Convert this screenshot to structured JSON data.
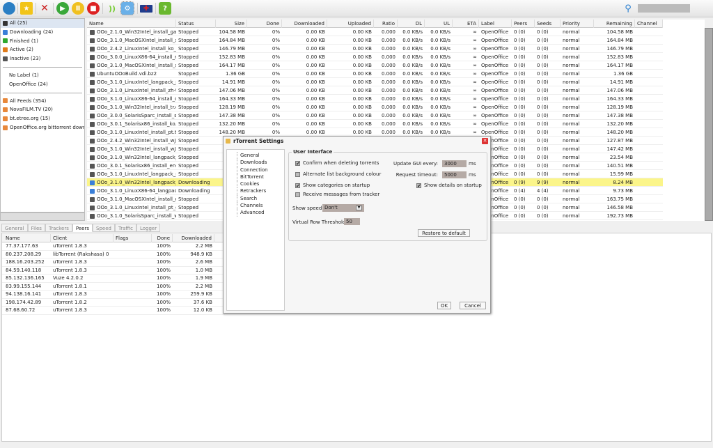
{
  "toolbar": {
    "icons": [
      "globe-icon",
      "star-icon",
      "delete-icon",
      "start-icon",
      "pause-icon",
      "stop-icon",
      "rss-icon",
      "settings-icon",
      "language-flag-icon",
      "help-icon"
    ],
    "search_value": ""
  },
  "sidebar": {
    "status": [
      {
        "label": "All (25)",
        "color": "#333"
      },
      {
        "label": "Downloading (24)",
        "color": "#3a7fd8"
      },
      {
        "label": "Finished (1)",
        "color": "#2ea82e"
      },
      {
        "label": "Active (2)",
        "color": "#e07b1a"
      },
      {
        "label": "Inactive (23)",
        "color": "#555"
      }
    ],
    "labels": [
      "No Label (1)",
      "OpenOffice (24)"
    ],
    "feeds": [
      "All Feeds (354)",
      "NovaFILM.TV (20)",
      "bt.etree.org (15)",
      "OpenOffice.org bittorrent downloa"
    ]
  },
  "table": {
    "columns": [
      "Name",
      "Status",
      "Size",
      "Done",
      "Downloaded",
      "Uploaded",
      "Ratio",
      "DL",
      "UL",
      "ETA",
      "Label",
      "Peers",
      "Seeds",
      "Priority",
      "Remaining",
      "Channel"
    ],
    "rows": [
      [
        "OOo_2.1.0_Win32Intel_install_ga.",
        "Stopped",
        "104.58 MB",
        "0%",
        "0.00 KB",
        "0.00 KB",
        "0.000",
        "0.0 KB/s",
        "0.0 KB/s",
        "∞",
        "OpenOffice",
        "0 (0)",
        "0 (0)",
        "normal",
        "104.58 MB",
        ""
      ],
      [
        "OOo_3.1.0_MacOSXIntel_install_sv",
        "Stopped",
        "164.84 MB",
        "0%",
        "0.00 KB",
        "0.00 KB",
        "0.000",
        "0.0 KB/s",
        "0.0 KB/s",
        "∞",
        "OpenOffice",
        "0 (0)",
        "0 (0)",
        "normal",
        "164.84 MB",
        ""
      ],
      [
        "OOo_2.4.2_LinuxIntel_install_ko_d",
        "Stopped",
        "146.79 MB",
        "0%",
        "0.00 KB",
        "0.00 KB",
        "0.000",
        "0.0 KB/s",
        "0.0 KB/s",
        "∞",
        "OpenOffice",
        "0 (0)",
        "0 (0)",
        "normal",
        "146.79 MB",
        ""
      ],
      [
        "OOo_3.0.0_LinuxX86-64_install_ru",
        "Stopped",
        "152.83 MB",
        "0%",
        "0.00 KB",
        "0.00 KB",
        "0.000",
        "0.0 KB/s",
        "0.0 KB/s",
        "∞",
        "OpenOffice",
        "0 (0)",
        "0 (0)",
        "normal",
        "152.83 MB",
        ""
      ],
      [
        "OOo_3.1.0_MacOSXIntel_install_sr",
        "Stopped",
        "164.17 MB",
        "0%",
        "0.00 KB",
        "0.00 KB",
        "0.000",
        "0.0 KB/s",
        "0.0 KB/s",
        "∞",
        "OpenOffice",
        "0 (0)",
        "0 (0)",
        "normal",
        "164.17 MB",
        ""
      ],
      [
        "UbuntuOOoBuild.vdi.bz2",
        "Stopped",
        "1.36 GB",
        "0%",
        "0.00 KB",
        "0.00 KB",
        "0.000",
        "0.0 KB/s",
        "0.0 KB/s",
        "∞",
        "OpenOffice",
        "0 (0)",
        "0 (0)",
        "normal",
        "1.36 GB",
        ""
      ],
      [
        "OOo_3.1.0_LinuxIntel_langpack_pl",
        "Stopped",
        "14.91 MB",
        "0%",
        "0.00 KB",
        "0.00 KB",
        "0.000",
        "0.0 KB/s",
        "0.0 KB/s",
        "∞",
        "OpenOffice",
        "0 (0)",
        "0 (0)",
        "normal",
        "14.91 MB",
        ""
      ],
      [
        "OOo_3.1.0_LinuxIntel_install_zh-tw",
        "Stopped",
        "147.06 MB",
        "0%",
        "0.00 KB",
        "0.00 KB",
        "0.000",
        "0.0 KB/s",
        "0.0 KB/s",
        "∞",
        "OpenOffice",
        "0 (0)",
        "0 (0)",
        "normal",
        "147.06 MB",
        ""
      ],
      [
        "OOo_3.1.0_LinuxX86-64_install_de",
        "Stopped",
        "164.33 MB",
        "0%",
        "0.00 KB",
        "0.00 KB",
        "0.000",
        "0.0 KB/s",
        "0.0 KB/s",
        "∞",
        "OpenOffice",
        "0 (0)",
        "0 (0)",
        "normal",
        "164.33 MB",
        ""
      ],
      [
        "OOo_3.1.0_Win32Intel_install_tr.e",
        "Stopped",
        "128.19 MB",
        "0%",
        "0.00 KB",
        "0.00 KB",
        "0.000",
        "0.0 KB/s",
        "0.0 KB/s",
        "∞",
        "OpenOffice",
        "0 (0)",
        "0 (0)",
        "normal",
        "128.19 MB",
        ""
      ],
      [
        "OOo_3.0.0_SolarisSparc_install_sv",
        "Stopped",
        "147.38 MB",
        "0%",
        "0.00 KB",
        "0.00 KB",
        "0.000",
        "0.0 KB/s",
        "0.0 KB/s",
        "∞",
        "OpenOffice",
        "0 (0)",
        "0 (0)",
        "normal",
        "147.38 MB",
        ""
      ],
      [
        "OOo_3.0.1_Solarisx86_install_ko.t",
        "Stopped",
        "132.20 MB",
        "0%",
        "0.00 KB",
        "0.00 KB",
        "0.000",
        "0.0 KB/s",
        "0.0 KB/s",
        "∞",
        "OpenOffice",
        "0 (0)",
        "0 (0)",
        "normal",
        "132.20 MB",
        ""
      ],
      [
        "OOo_3.1.0_LinuxIntel_install_pt.ta",
        "Stopped",
        "148.20 MB",
        "0%",
        "0.00 KB",
        "0.00 KB",
        "0.000",
        "0.0 KB/s",
        "0.0 KB/s",
        "∞",
        "OpenOffice",
        "0 (0)",
        "0 (0)",
        "normal",
        "148.20 MB",
        ""
      ],
      [
        "OOo_2.4.2_Win32Intel_install_wJF",
        "Stopped",
        "",
        "",
        "",
        "",
        "",
        "",
        "",
        "",
        "OpenOffice",
        "0 (0)",
        "0 (0)",
        "normal",
        "127.87 MB",
        ""
      ],
      [
        "OOo_3.1.0_Win32Intel_install_wJF",
        "Stopped",
        "",
        "",
        "",
        "",
        "",
        "",
        "",
        "",
        "OpenOffice",
        "0 (0)",
        "0 (0)",
        "normal",
        "147.42 MB",
        ""
      ],
      [
        "OOo_3.1.0_Win32Intel_langpack_r",
        "Stopped",
        "",
        "",
        "",
        "",
        "",
        "",
        "",
        "",
        "OpenOffice",
        "0 (0)",
        "0 (0)",
        "normal",
        "23.54 MB",
        ""
      ],
      [
        "OOo_3.0.1_Solarisx86_install_en-L",
        "Stopped",
        "",
        "",
        "",
        "",
        "",
        "",
        "",
        "",
        "OpenOffice",
        "0 (0)",
        "0 (0)",
        "normal",
        "140.51 MB",
        ""
      ],
      [
        "OOo_3.1.0_LinuxIntel_langpack_n.",
        "Stopped",
        "",
        "",
        "",
        "",
        "",
        "",
        "",
        "",
        "OpenOffice",
        "0 (0)",
        "0 (0)",
        "normal",
        "15.99 MB",
        ""
      ],
      [
        "OOo_3.1.0_Win32Intel_langpack_r",
        "Downloading",
        "",
        "",
        "",
        "",
        "",
        "",
        "",
        "",
        "OpenOffice",
        "0 (9)",
        "9 (9)",
        "normal",
        "8.24 MB",
        ""
      ],
      [
        "OOo_3.1.0_LinuxX86-64_langpack",
        "Downloading",
        "",
        "",
        "",
        "",
        "",
        "",
        "",
        "",
        "OpenOffice",
        "0 (4)",
        "4 (4)",
        "normal",
        "9.73 MB",
        ""
      ],
      [
        "OOo_3.1.0_MacOSXIntel_install_es",
        "Stopped",
        "",
        "",
        "",
        "",
        "",
        "",
        "",
        "",
        "OpenOffice",
        "0 (0)",
        "0 (0)",
        "normal",
        "163.75 MB",
        ""
      ],
      [
        "OOo_3.1.0_LinuxIntel_install_pt_d",
        "Stopped",
        "",
        "",
        "",
        "",
        "",
        "",
        "",
        "",
        "OpenOffice",
        "0 (0)",
        "0 (0)",
        "normal",
        "146.58 MB",
        ""
      ],
      [
        "OOo_3.1.0_SolarisSparc_install_w.",
        "Stopped",
        "",
        "",
        "",
        "",
        "",
        "",
        "",
        "",
        "OpenOffice",
        "0 (0)",
        "0 (0)",
        "normal",
        "192.73 MB",
        ""
      ]
    ],
    "highlight_row": 18,
    "highlight_color": "#fbf58a"
  },
  "tabs": [
    {
      "label": "General"
    },
    {
      "label": "Files"
    },
    {
      "label": "Trackers"
    },
    {
      "label": "Peers",
      "active": true
    },
    {
      "label": "Speed"
    },
    {
      "label": "Traffic"
    },
    {
      "label": "Logger"
    }
  ],
  "peers": {
    "columns": [
      "Name",
      "Client",
      "Flags",
      "Done",
      "Downloaded"
    ],
    "rows": [
      [
        "77.37.177.63",
        "uTorrent 1.8.3",
        "",
        "100%",
        "2.2 MB"
      ],
      [
        "80.237.208.29",
        "libTorrent (Rakshasa) 0",
        "",
        "100%",
        "948.9 KB"
      ],
      [
        "188.16.203.252",
        "uTorrent 1.8.3",
        "",
        "100%",
        "2.6 MB"
      ],
      [
        "84.59.140.118",
        "uTorrent 1.8.3",
        "",
        "100%",
        "1.0 MB"
      ],
      [
        "85.132.136.165",
        "Vuze 4.2.0.2",
        "",
        "100%",
        "1.9 MB"
      ],
      [
        "83.99.155.144",
        "uTorrent 1.8.1",
        "",
        "100%",
        "2.2 MB"
      ],
      [
        "94.138.16.141",
        "uTorrent 1.8.3",
        "",
        "100%",
        "259.9 KB"
      ],
      [
        "198.174.42.89",
        "uTorrent 1.8.2",
        "",
        "100%",
        "37.6 KB"
      ],
      [
        "87.68.60.72",
        "uTorrent 1.8.3",
        "",
        "100%",
        "12.0 KB"
      ]
    ]
  },
  "dialog": {
    "title": "rTorrent Settings",
    "nav": [
      "General",
      "Downloads",
      "Connection",
      "BitTorrent",
      "Cookies",
      "Retrackers",
      "Search",
      "Channels",
      "Advanced"
    ],
    "group_title": "User Interface",
    "confirm_delete": {
      "label": "Confirm when deleting torrents",
      "checked": true
    },
    "alt_bg": {
      "label": "Alternate list background colour",
      "checked": false
    },
    "show_categories": {
      "label": "Show categories on startup",
      "checked": true
    },
    "receive_messages": {
      "label": "Receive messages from tracker",
      "checked": false
    },
    "show_details": {
      "label": "Show details on startup",
      "checked": true
    },
    "update_gui_label": "Update GUI every:",
    "update_gui_value": "3000",
    "update_gui_unit": "ms",
    "request_timeout_label": "Request timeout:",
    "request_timeout_value": "5000",
    "request_timeout_unit": "ms",
    "show_speed_label": "Show speed:",
    "show_speed_value": "Don't",
    "virtual_row_label": "Virtual Row Threshold:",
    "virtual_row_value": "50",
    "restore_label": "Restore to default",
    "ok_label": "OK",
    "cancel_label": "Cancel"
  }
}
